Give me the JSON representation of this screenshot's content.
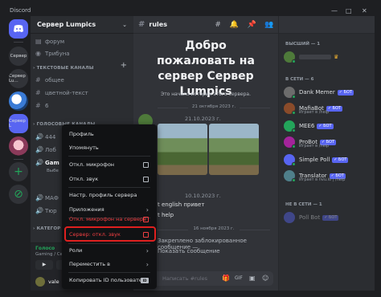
{
  "window": {
    "app_name": "Discord",
    "controls": [
      "—",
      "□",
      "✕"
    ]
  },
  "guilds": {
    "items": [
      {
        "label": "Сервер"
      },
      {
        "label": "Сервер Lu..."
      },
      {
        "label": ""
      },
      {
        "label": "Сервер L"
      },
      {
        "label": ""
      }
    ]
  },
  "sidebar": {
    "server_name": "Сервер Lumpics",
    "channels_top": [
      {
        "label": "форум"
      },
      {
        "label": "Трибуна"
      }
    ],
    "text_category": "ТЕКСТОВЫЕ КАНАЛЫ",
    "text_channels": [
      {
        "label": "общее"
      },
      {
        "label": "цветной-текст"
      },
      {
        "label": "6"
      }
    ],
    "voice_category": "ГОЛОСОВЫЕ КАНАЛЫ",
    "voice_channels": [
      {
        "label": "444"
      },
      {
        "label": "Лоб"
      },
      {
        "label": "Gam"
      },
      {
        "label": "Выбе"
      }
    ],
    "more": [
      {
        "label": "МАФ"
      },
      {
        "label": "Тюр"
      }
    ],
    "category_prefix": "КАТЕГОР",
    "voice_status": "Голосо",
    "voice_location": "Gaming / Серве",
    "user_name": "vale"
  },
  "chat": {
    "channel": "rules",
    "welcome_title": "Добро пожаловать на сервер Сервер Lumpics",
    "welcome_sub": "Это начало истории этого сервера.",
    "dates": [
      "21 октября 2023 г.",
      "21.10.2023 г.",
      "10.10.2023 г.",
      "16 ноября 2023 г."
    ],
    "messages": [
      {
        "text": "t english привет"
      },
      {
        "text": "t help"
      },
      {
        "text": "Закреплено заблокированное сообщение —"
      },
      {
        "text": "Показать сообщение"
      }
    ],
    "composer_placeholder": "Написать #rules"
  },
  "members": {
    "groups": [
      {
        "label": "ВЫСШИЙ — 1"
      },
      {
        "label": "В СЕТИ — 6"
      },
      {
        "label": "НЕ В СЕТИ — 1"
      }
    ],
    "top": [
      {
        "name": "",
        "color": "#4e7a3a",
        "crown": "♛"
      }
    ],
    "online": [
      {
        "name": "Dank Memer",
        "bot": "✓ БОТ",
        "status": "",
        "color": "#6c6c6c"
      },
      {
        "name": "MafiaBot",
        "bot": "✓ БОТ",
        "status": "Играет в /help",
        "color": "#8a4b2a"
      },
      {
        "name": "MEE6",
        "bot": "✓ БОТ",
        "status": "",
        "color": "#23a55a"
      },
      {
        "name": "ProBot",
        "bot": "✓ БОТ",
        "status": "Играет в /help",
        "color": "#a3249a"
      },
      {
        "name": "Simple Poll",
        "bot": "✓ БОТ",
        "status": "",
        "color": "#5865f2"
      },
      {
        "name": "Translator",
        "bot": "✓ БОТ",
        "status": "Играет в nvu.io | /help",
        "color": "#4f7f8a"
      }
    ],
    "offline": [
      {
        "name": "Poll Bot",
        "bot": "✓ БОТ",
        "color": "#5865f2"
      }
    ]
  },
  "context_menu": {
    "items": [
      {
        "label": "Профиль"
      },
      {
        "label": "Упомянуть"
      },
      {
        "label": "Откл. микрофон"
      },
      {
        "label": "Откл. звук"
      },
      {
        "label": "Настр. профиль сервера"
      },
      {
        "label": "Приложения"
      },
      {
        "label": "Откл. микрофон на сервере"
      },
      {
        "label": "Сервер: откл. звук"
      },
      {
        "label": "Роли"
      },
      {
        "label": "Переместить в"
      },
      {
        "label": "Копировать ID пользователя"
      }
    ],
    "copy_id_badge": "ID"
  }
}
